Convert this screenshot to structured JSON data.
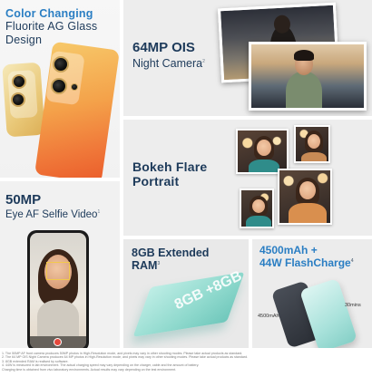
{
  "cards": {
    "color": {
      "line1": "Color Changing",
      "line2": "Fluorite AG Glass",
      "line3": "Design"
    },
    "night": {
      "title": "64MP OIS",
      "subtitle": "Night Camera",
      "sup": "2"
    },
    "bokeh": {
      "line1": "Bokeh Flare",
      "line2": "Portrait"
    },
    "selfie": {
      "title": "50MP",
      "subtitle": "Eye AF Selfie Video",
      "sup": "1"
    },
    "ram": {
      "line1": "8GB Extended",
      "line2": "RAM",
      "sup": "3",
      "chip_text": "8GB +8GB"
    },
    "battery": {
      "line1": "4500mAh +",
      "line2": "44W FlashCharge",
      "sup": "4",
      "label_capacity": "4500mAh",
      "label_time": "30mins"
    }
  },
  "footnotes": [
    "1. The 50MP AF front camera produces 50MP photos in High-Resolution mode, and pixels may vary in other shooting modes. Please take actual products as standard.",
    "2. The 64 MP OIS Night Camera produces 64 MP photos in High-Resolution mode, and pixels may vary in other shooting modes. Please take actual products as standard.",
    "3. 8GB extended RAM is realised by software.",
    "4. 44W is measured in lab environment. The actual charging speed may vary depending on the charger, cable and the amount of battery.",
    "Charging time is obtained from vivo laboratory environments. Actual results may vary depending on the test environment."
  ],
  "colors": {
    "title": "#1d3a5a",
    "accent": "#2a7ec3",
    "orange": "#f07a3a",
    "mint": "#8fd9cd"
  }
}
